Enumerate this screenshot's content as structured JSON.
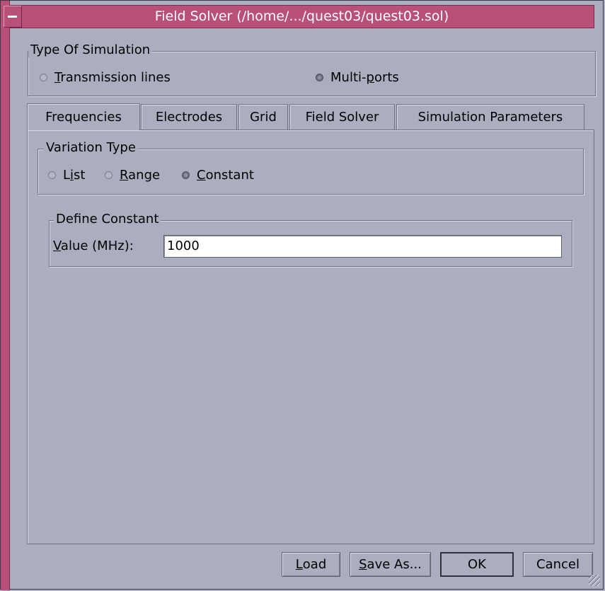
{
  "window": {
    "title": "Field Solver (/home/.../quest03/quest03.sol)"
  },
  "simulation_type": {
    "label": "Type Of Simulation",
    "options": [
      {
        "label": "Transmission lines",
        "mnemonic": "T",
        "rest": "ransmission lines",
        "selected": false
      },
      {
        "label": "Multi-ports",
        "pre": "Multi-",
        "mnemonic": "p",
        "rest": "orts",
        "selected": true
      }
    ]
  },
  "tabs": [
    {
      "label": "Frequencies",
      "active": true
    },
    {
      "label": "Electrodes",
      "active": false
    },
    {
      "label": "Grid",
      "active": false
    },
    {
      "label": "Field Solver",
      "active": false
    },
    {
      "label": "Simulation Parameters",
      "active": false
    }
  ],
  "variation_type": {
    "label": "Variation Type",
    "options": [
      {
        "label": "List",
        "pre": "L",
        "mnemonic": "i",
        "rest": "st",
        "selected": false
      },
      {
        "label": "Range",
        "pre": "",
        "mnemonic": "R",
        "rest": "ange",
        "selected": false
      },
      {
        "label": "Constant",
        "pre": "",
        "mnemonic": "C",
        "rest": "onstant",
        "selected": true
      }
    ]
  },
  "define_constant": {
    "label": "Define Constant",
    "field_label_mnemonic": "V",
    "field_label_rest": "alue (MHz):",
    "value": "1000"
  },
  "buttons": {
    "load": {
      "mnemonic": "L",
      "rest": "oad"
    },
    "save_as": {
      "mnemonic": "S",
      "rest": "ave As..."
    },
    "ok": "OK",
    "cancel": "Cancel"
  },
  "colors": {
    "window_bg": "#aaaebe",
    "title_bar": "#b8507a",
    "field_bg": "#ffffff"
  }
}
